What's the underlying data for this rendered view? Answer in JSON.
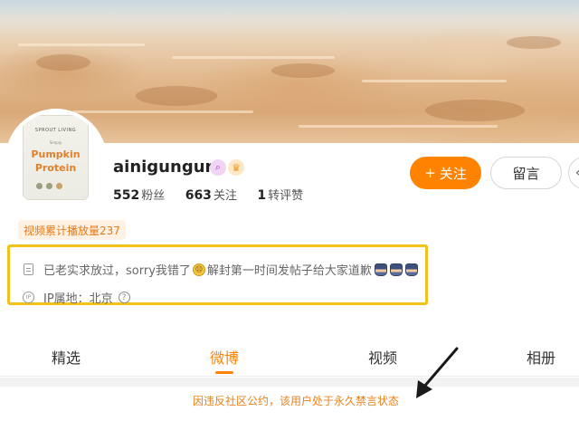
{
  "profile": {
    "username": "ainigungun",
    "avatar": {
      "brand": "SPROUT LIVING",
      "line_small": "Simply",
      "line1": "Pumpkin",
      "line2": "Protein"
    },
    "badges": [
      "search-badge-icon",
      "crown-badge-icon"
    ],
    "stats": [
      {
        "value": "552",
        "label": "粉丝"
      },
      {
        "value": "663",
        "label": "关注"
      },
      {
        "value": "1",
        "label": "转评赞"
      }
    ]
  },
  "actions": {
    "follow_label": "关注",
    "follow_icon": "+",
    "message_label": "留言",
    "more_icon": "‹"
  },
  "video_tag": "视频累计播放量237",
  "info": {
    "bio_part1": "已老实求放过，sorry我错了",
    "bio_part2": "解封第一时间发帖子给大家道歉",
    "ip_label": "IP属地：北京",
    "ip_icon_text": "IP",
    "help_icon_text": "?"
  },
  "tabs": [
    "精选",
    "微博",
    "视频",
    "相册"
  ],
  "active_tab": "微博",
  "notice": "因违反社区公约，该用户处于永久禁言状态",
  "colors": {
    "accent": "#ff8200",
    "highlight_border": "#f2c21b",
    "notice_text": "#e8821d",
    "arrow": "#1a1a1a"
  }
}
